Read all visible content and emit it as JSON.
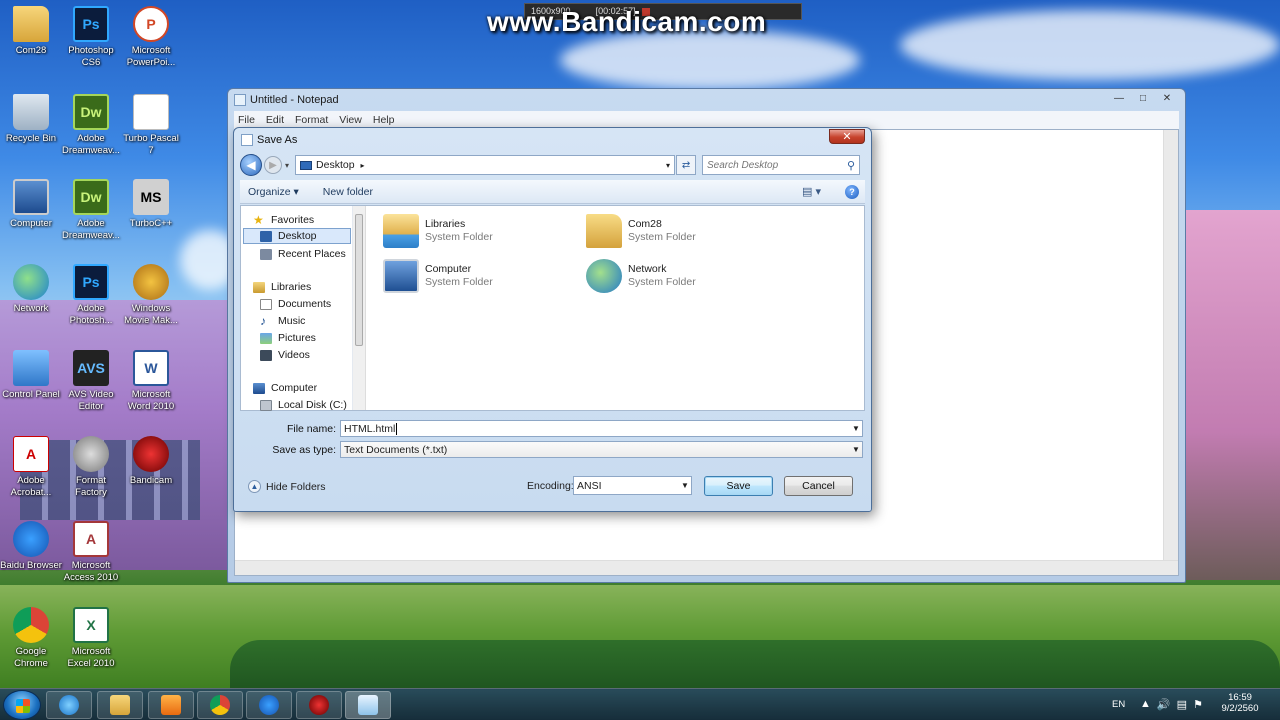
{
  "watermark": "www.Bandicam.com",
  "recorder": {
    "resolution": "1600x900",
    "timer": "[00:02:57]"
  },
  "desktop_icons": [
    {
      "label": "Com28",
      "glyph": ""
    },
    {
      "label": "Photoshop CS6",
      "glyph": "Ps"
    },
    {
      "label": "Microsoft PowerPoi...",
      "glyph": "P"
    },
    {
      "label": "Recycle Bin",
      "glyph": ""
    },
    {
      "label": "Adobe Dreamweav...",
      "glyph": "Dw"
    },
    {
      "label": "Turbo Pascal 7",
      "glyph": ""
    },
    {
      "label": "Computer",
      "glyph": ""
    },
    {
      "label": "Adobe Dreamweav...",
      "glyph": "Dw"
    },
    {
      "label": "TurboC++",
      "glyph": "MS"
    },
    {
      "label": "Network",
      "glyph": ""
    },
    {
      "label": "Adobe Photosh...",
      "glyph": "Ps"
    },
    {
      "label": "Windows Movie Mak...",
      "glyph": ""
    },
    {
      "label": "Control Panel",
      "glyph": ""
    },
    {
      "label": "AVS Video Editor",
      "glyph": "AVS"
    },
    {
      "label": "Microsoft Word 2010",
      "glyph": "W"
    },
    {
      "label": "Adobe Acrobat...",
      "glyph": "A"
    },
    {
      "label": "Format Factory",
      "glyph": ""
    },
    {
      "label": "Bandicam",
      "glyph": ""
    },
    {
      "label": "Baidu Browser",
      "glyph": ""
    },
    {
      "label": "Microsoft Access 2010",
      "glyph": "A"
    },
    {
      "label": "Google Chrome",
      "glyph": ""
    },
    {
      "label": "Microsoft Excel 2010",
      "glyph": "X"
    }
  ],
  "notepad": {
    "title": "Untitled - Notepad",
    "menu": [
      "File",
      "Edit",
      "Format",
      "View",
      "Help"
    ],
    "buttons": {
      "minimize": "—",
      "maximize": "□",
      "close": "✕"
    }
  },
  "dialog": {
    "title": "Save As",
    "close": "✕",
    "address": {
      "location": "Desktop",
      "separator": "▸",
      "dropdown": "▾"
    },
    "search_placeholder": "Search Desktop",
    "toolbar": {
      "organize": "Organize ▾",
      "new_folder": "New folder",
      "views": "▤ ▾",
      "help": "?"
    },
    "nav_tree": {
      "favorites": "Favorites",
      "desktop": "Desktop",
      "recent": "Recent Places",
      "libraries": "Libraries",
      "documents": "Documents",
      "music": "Music",
      "pictures": "Pictures",
      "videos": "Videos",
      "computer": "Computer",
      "local_disk": "Local Disk (C:)"
    },
    "items": [
      {
        "name": "Libraries",
        "type": "System Folder"
      },
      {
        "name": "Com28",
        "type": "System Folder"
      },
      {
        "name": "Computer",
        "type": "System Folder"
      },
      {
        "name": "Network",
        "type": "System Folder"
      }
    ],
    "file_name_label": "File name:",
    "file_name_value": "HTML.html",
    "save_type_label": "Save as type:",
    "save_type_value": "Text Documents (*.txt)",
    "hide_folders": "Hide Folders",
    "encoding_label": "Encoding:",
    "encoding_value": "ANSI",
    "save_label": "Save",
    "cancel_label": "Cancel"
  },
  "taskbar": {
    "language": "EN",
    "time": "16:59",
    "date": "9/2/2560"
  }
}
